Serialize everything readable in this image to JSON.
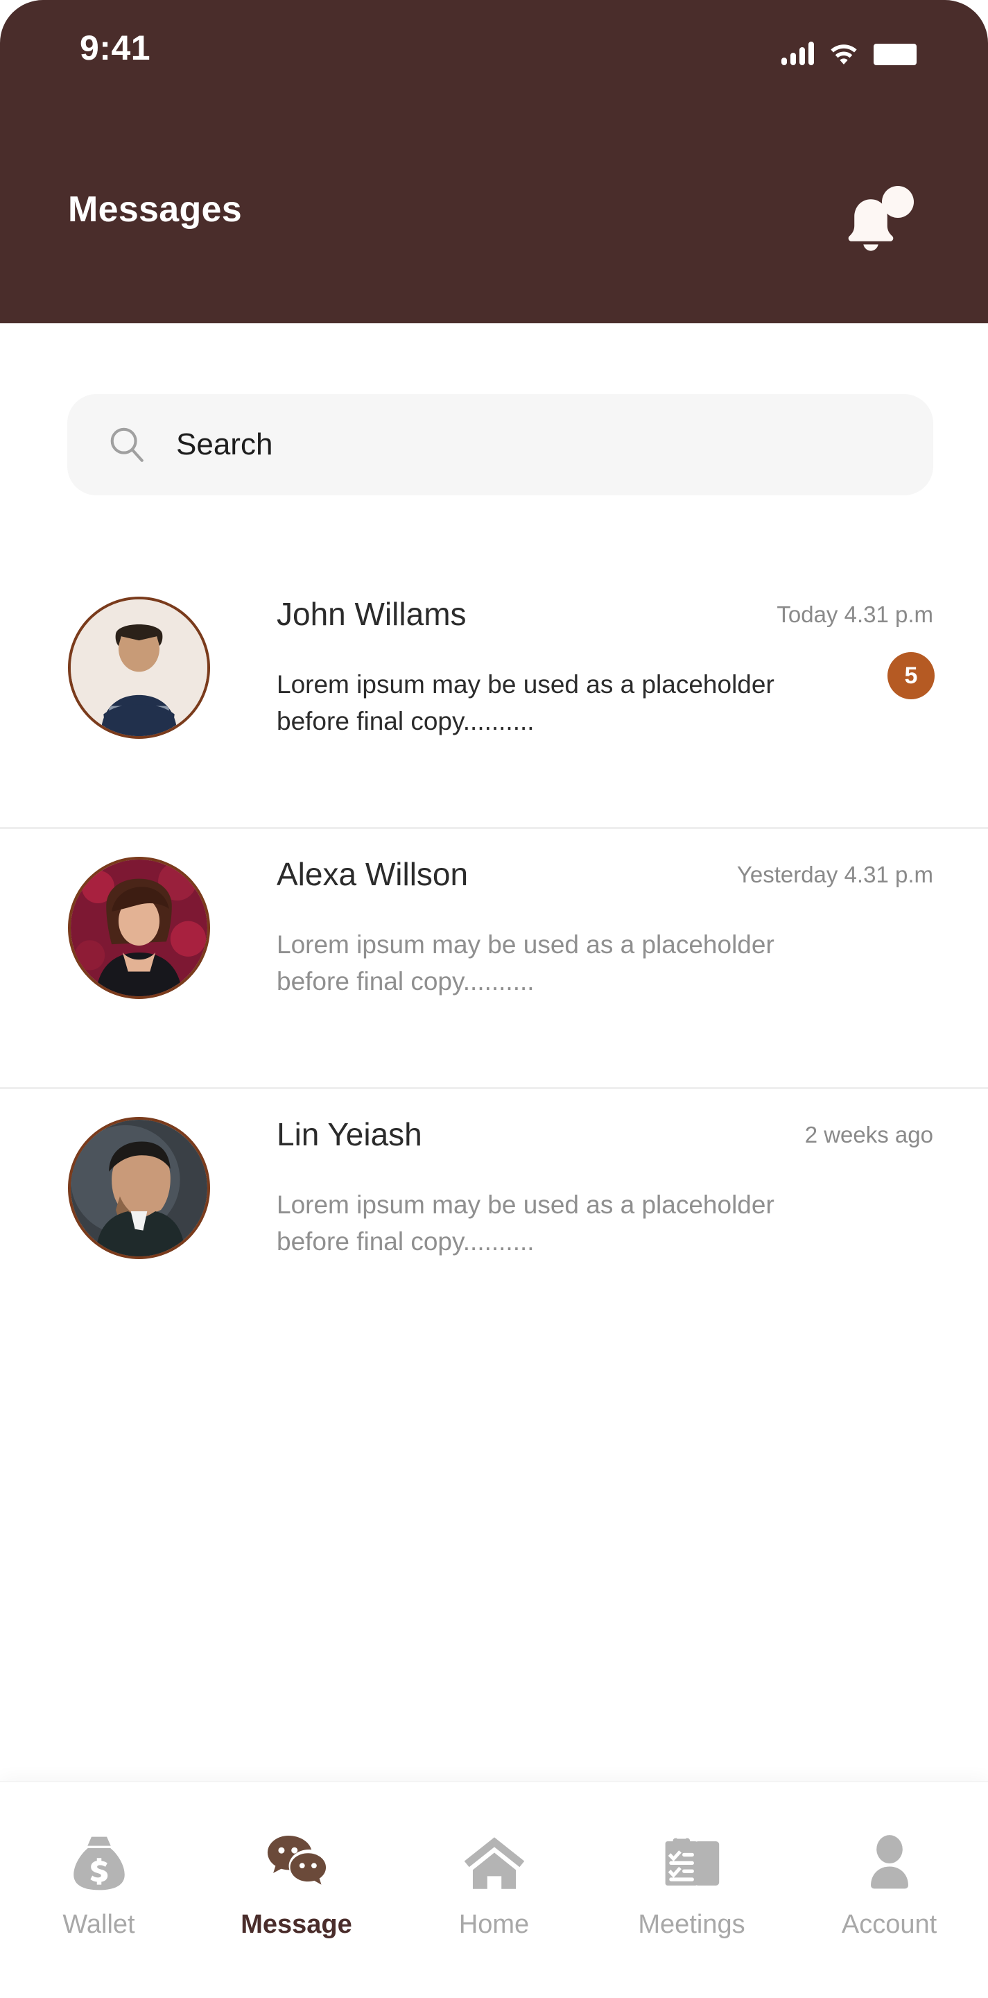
{
  "theme": {
    "header_bg": "#4a2d2b",
    "accent_brown": "#6b4a3a",
    "badge_orange": "#b55a23",
    "avatar_ring": "#7a3b1c",
    "muted_text": "#8f8f8f",
    "search_bg": "#f6f6f6"
  },
  "status_bar": {
    "time": "9:41",
    "signal_icon": "signal-bars-icon",
    "wifi_icon": "wifi-icon",
    "battery_icon": "battery-full-icon"
  },
  "header": {
    "title": "Messages",
    "bell_icon": "notification-bell-icon",
    "bell_has_dot": true
  },
  "search": {
    "icon": "search-icon",
    "placeholder": "Search",
    "value": ""
  },
  "messages": [
    {
      "name": "John Willams",
      "time": "Today 4.31 p.m",
      "preview": "Lorem ipsum may be used as a placeholder before final copy..........",
      "unread": true,
      "badge": "5",
      "avatar": "avatar-john-willams"
    },
    {
      "name": "Alexa Willson",
      "time": "Yesterday 4.31 p.m",
      "preview": "Lorem ipsum may be used as a placeholder before final copy..........",
      "unread": false,
      "badge": "",
      "avatar": "avatar-alexa-willson"
    },
    {
      "name": "Lin Yeiash",
      "time": "2 weeks ago",
      "preview": "Lorem ipsum may be used as a placeholder before final copy..........",
      "unread": false,
      "badge": "",
      "avatar": "avatar-lin-yeiash"
    }
  ],
  "bottom_nav": {
    "active_index": 1,
    "items": [
      {
        "label": "Wallet",
        "icon": "money-bag-icon"
      },
      {
        "label": "Message",
        "icon": "chat-bubbles-icon"
      },
      {
        "label": "Home",
        "icon": "house-icon"
      },
      {
        "label": "Meetings",
        "icon": "clipboard-checklist-icon"
      },
      {
        "label": "Account",
        "icon": "person-icon"
      }
    ]
  }
}
